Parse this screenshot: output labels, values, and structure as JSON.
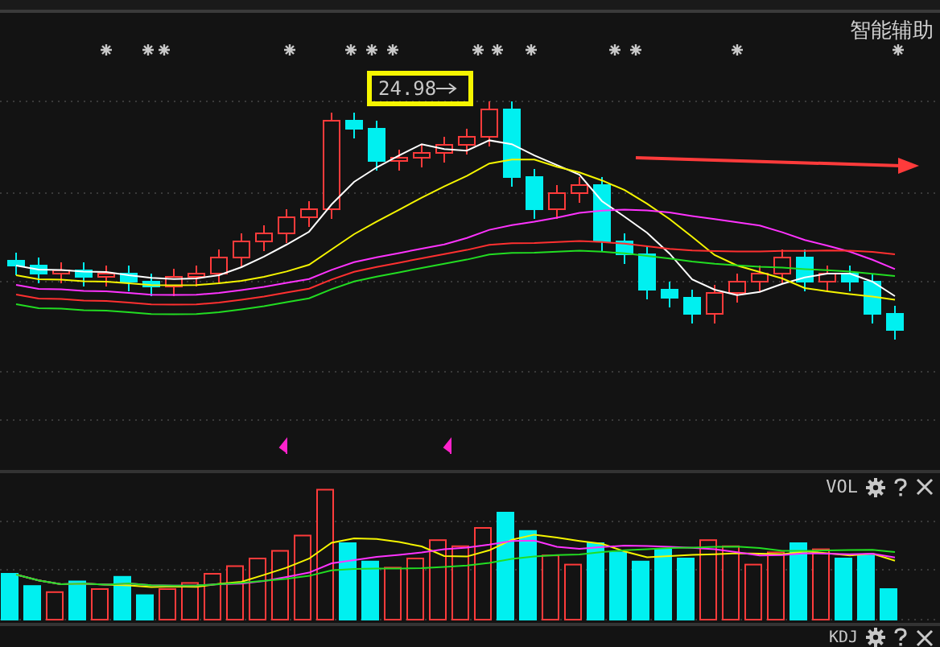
{
  "header": {
    "title": "智能辅助"
  },
  "main_chart": {
    "price_label": "24.98"
  },
  "panels": [
    {
      "name": "VOL"
    },
    {
      "name": "KDJ"
    }
  ]
}
